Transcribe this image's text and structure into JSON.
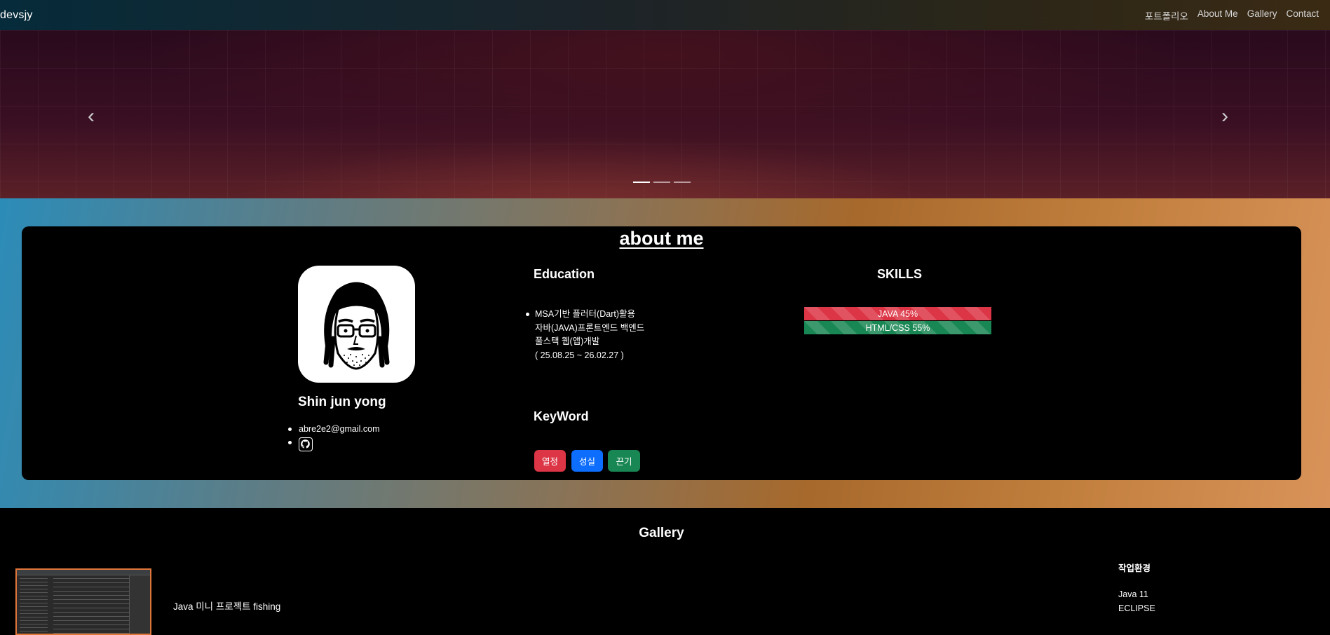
{
  "nav": {
    "brand": "devsjy",
    "links": [
      "포트폴리오",
      "About Me",
      "Gallery",
      "Contact"
    ]
  },
  "carousel": {
    "prev_icon": "chevron-left-icon",
    "next_icon": "chevron-right-icon",
    "slide_count": 3,
    "active_index": 0
  },
  "about": {
    "title": "about me",
    "name": "Shin jun yong",
    "email": "abre2e2@gmail.com",
    "github_icon": "github-icon",
    "education": {
      "heading": "Education",
      "lines": [
        "MSA기반 플러터(Dart)활용",
        "자바(JAVA)프론트엔드 백엔드",
        "풀스택 웹(앱)개발",
        "( 25.08.25 ~ 26.02.27 )"
      ]
    },
    "keyword": {
      "heading": "KeyWord",
      "items": [
        "열정",
        "성실",
        "끈기"
      ]
    },
    "skills": {
      "heading": "SKILLS",
      "items": [
        {
          "label": "JAVA 45%",
          "percent": 45
        },
        {
          "label": "HTML/CSS 55%",
          "percent": 55
        }
      ]
    }
  },
  "gallery": {
    "title": "Gallery",
    "project_name": "Java 미니 프로젝트 fishing",
    "env_heading": "작업환경",
    "env_items": [
      "Java 11",
      "ECLIPSE"
    ]
  },
  "colors": {
    "danger": "#dc3545",
    "primary": "#0d6efd",
    "success": "#198754",
    "thumb_border": "#e0763a"
  }
}
